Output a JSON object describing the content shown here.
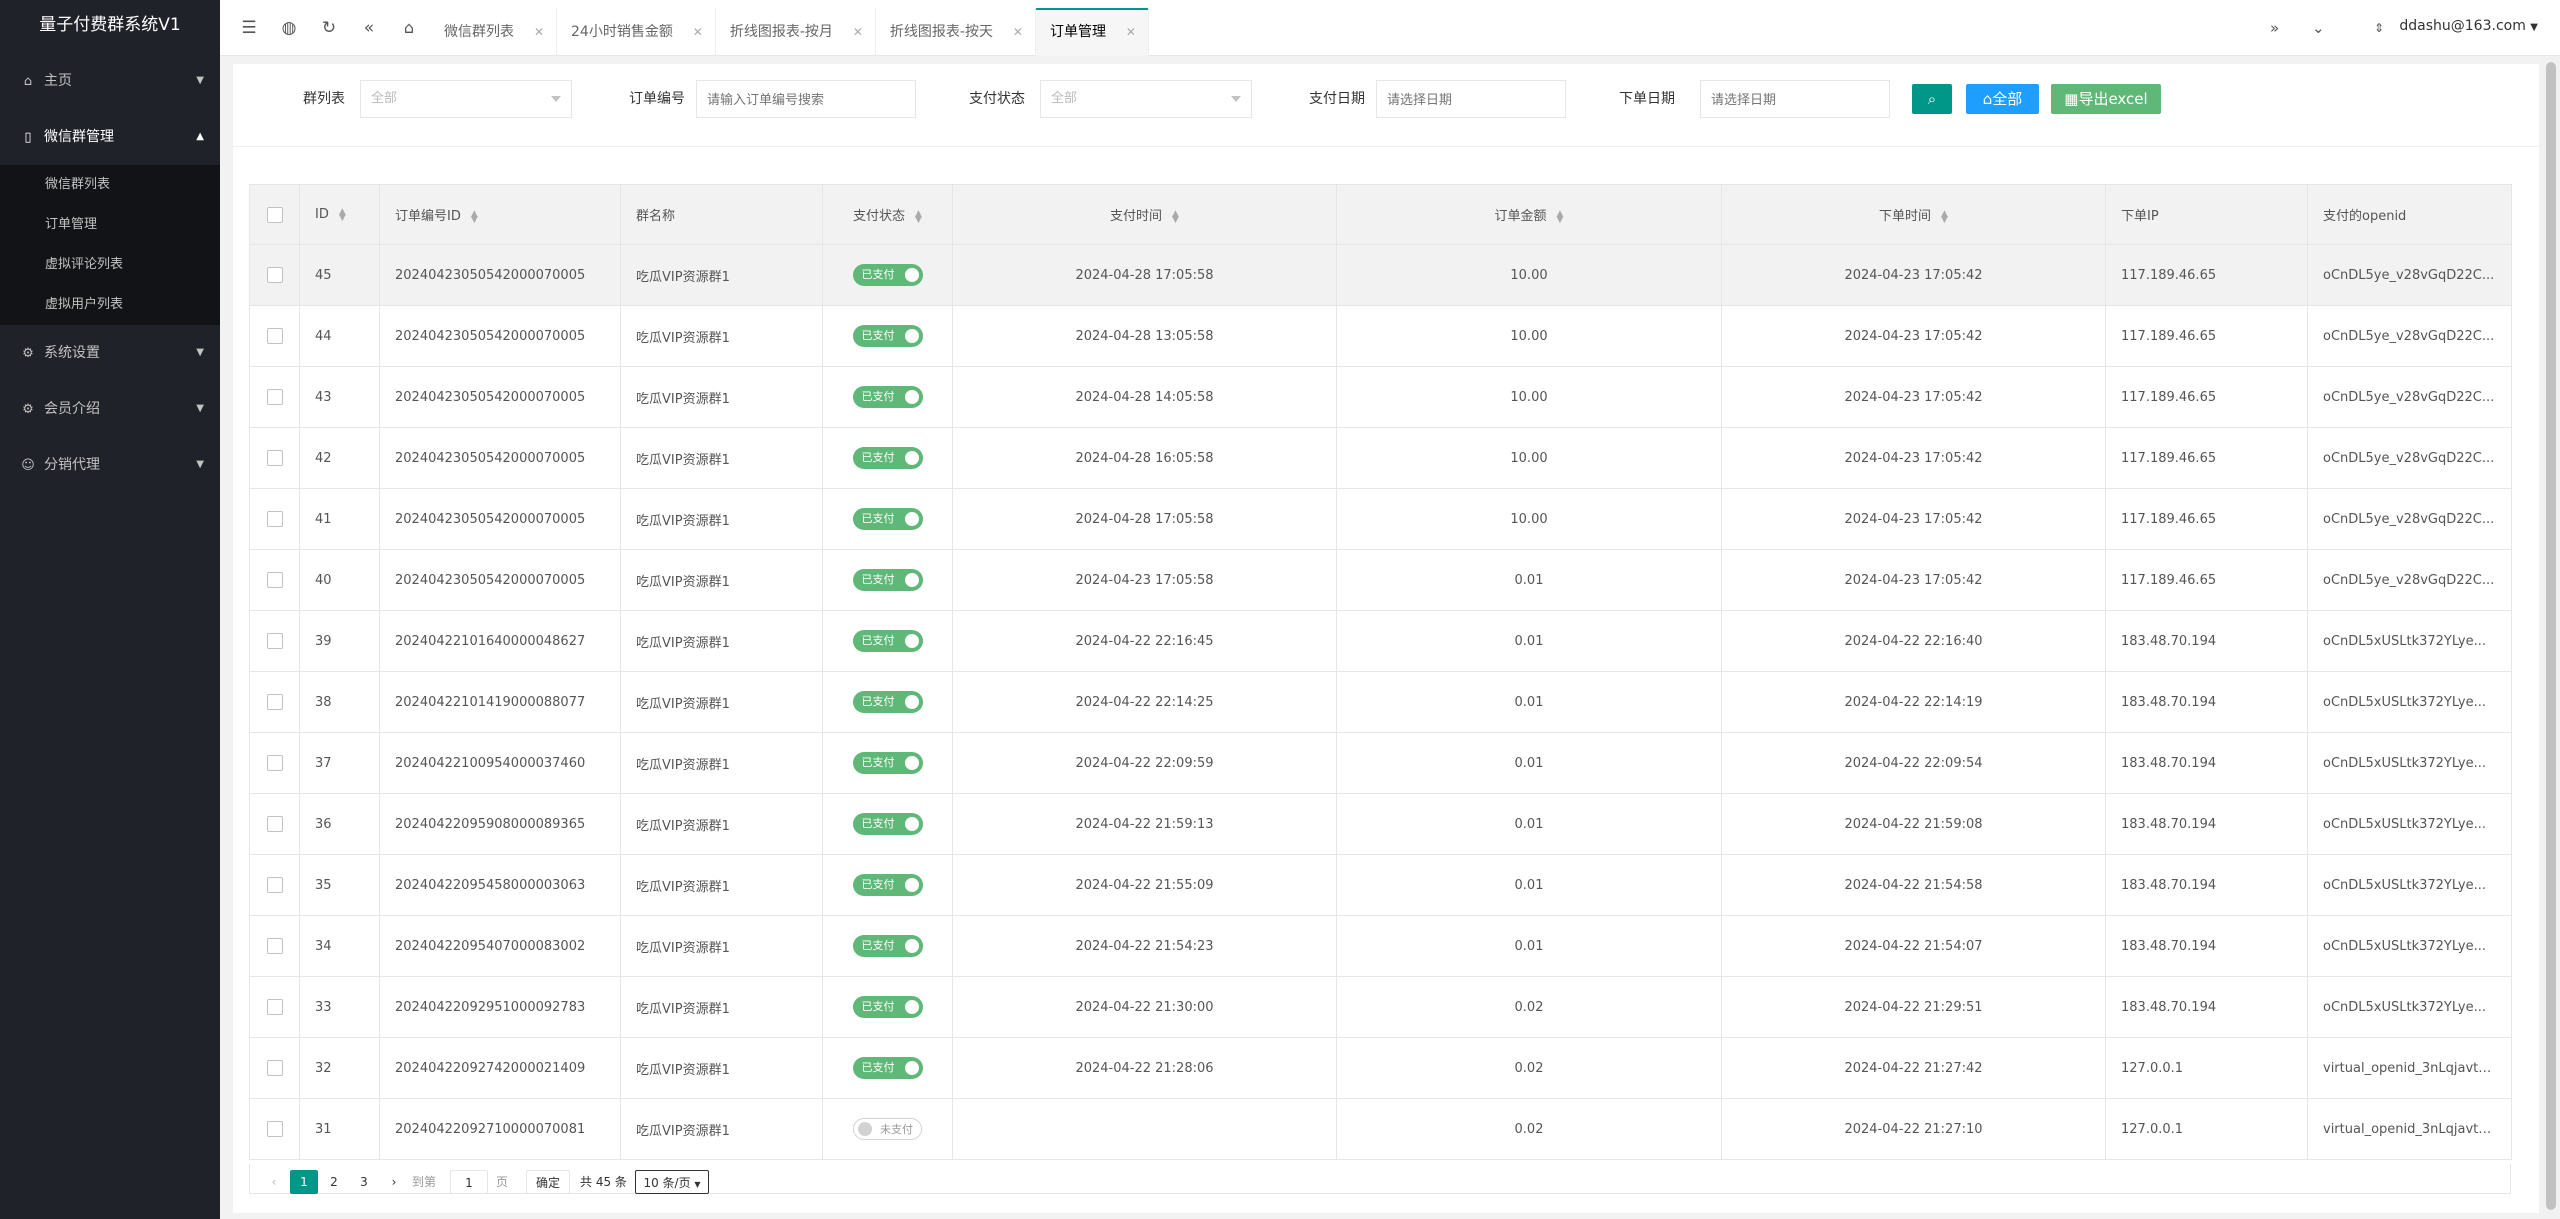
{
  "app": {
    "title": "量子付费群系统V1"
  },
  "sidebar": {
    "items": [
      {
        "label": "主页",
        "icon": "home-icon"
      },
      {
        "label": "微信群管理",
        "icon": "phone-icon"
      },
      {
        "label": "系统设置",
        "icon": "gear-icon"
      },
      {
        "label": "会员介绍",
        "icon": "badge-icon"
      },
      {
        "label": "分销代理",
        "icon": "user-icon"
      }
    ],
    "subitems": [
      "微信群列表",
      "订单管理",
      "虚拟评论列表",
      "虚拟用户列表"
    ]
  },
  "topbar": {
    "tabs": [
      "微信群列表",
      "24小时销售金额",
      "折线图报表-按月",
      "折线图报表-按天",
      "订单管理"
    ],
    "active_tab": "订单管理",
    "user": "ddashu@163.com"
  },
  "filters": {
    "group_label": "群列表",
    "group_value": "全部",
    "order_label": "订单编号",
    "order_placeholder": "请输入订单编号搜索",
    "pay_label": "支付状态",
    "pay_value": "全部",
    "paydate_label": "支付日期",
    "paydate_placeholder": "请选择日期",
    "orderdate_label": "下单日期",
    "orderdate_placeholder": "请选择日期",
    "all_button": "全部",
    "export_button": "导出excel"
  },
  "table": {
    "headers": [
      "ID",
      "订单编号ID",
      "群名称",
      "支付状态",
      "支付时间",
      "订单金额",
      "下单时间",
      "下单IP",
      "支付的openid"
    ],
    "rows": [
      {
        "id": "45",
        "order": "20240423050542000070005",
        "group": "吃瓜VIP资源群1",
        "status": "已支付",
        "paid": true,
        "pay_time": "2024-04-28 17:05:58",
        "amount": "10.00",
        "order_time": "2024-04-23 17:05:42",
        "ip": "117.189.46.65",
        "openid": "oCnDL5ye_v28vGqD22C..."
      },
      {
        "id": "44",
        "order": "20240423050542000070005",
        "group": "吃瓜VIP资源群1",
        "status": "已支付",
        "paid": true,
        "pay_time": "2024-04-28 13:05:58",
        "amount": "10.00",
        "order_time": "2024-04-23 17:05:42",
        "ip": "117.189.46.65",
        "openid": "oCnDL5ye_v28vGqD22C..."
      },
      {
        "id": "43",
        "order": "20240423050542000070005",
        "group": "吃瓜VIP资源群1",
        "status": "已支付",
        "paid": true,
        "pay_time": "2024-04-28 14:05:58",
        "amount": "10.00",
        "order_time": "2024-04-23 17:05:42",
        "ip": "117.189.46.65",
        "openid": "oCnDL5ye_v28vGqD22C..."
      },
      {
        "id": "42",
        "order": "20240423050542000070005",
        "group": "吃瓜VIP资源群1",
        "status": "已支付",
        "paid": true,
        "pay_time": "2024-04-28 16:05:58",
        "amount": "10.00",
        "order_time": "2024-04-23 17:05:42",
        "ip": "117.189.46.65",
        "openid": "oCnDL5ye_v28vGqD22C..."
      },
      {
        "id": "41",
        "order": "20240423050542000070005",
        "group": "吃瓜VIP资源群1",
        "status": "已支付",
        "paid": true,
        "pay_time": "2024-04-28 17:05:58",
        "amount": "10.00",
        "order_time": "2024-04-23 17:05:42",
        "ip": "117.189.46.65",
        "openid": "oCnDL5ye_v28vGqD22C..."
      },
      {
        "id": "40",
        "order": "20240423050542000070005",
        "group": "吃瓜VIP资源群1",
        "status": "已支付",
        "paid": true,
        "pay_time": "2024-04-23 17:05:58",
        "amount": "0.01",
        "order_time": "2024-04-23 17:05:42",
        "ip": "117.189.46.65",
        "openid": "oCnDL5ye_v28vGqD22C..."
      },
      {
        "id": "39",
        "order": "20240422101640000048627",
        "group": "吃瓜VIP资源群1",
        "status": "已支付",
        "paid": true,
        "pay_time": "2024-04-22 22:16:45",
        "amount": "0.01",
        "order_time": "2024-04-22 22:16:40",
        "ip": "183.48.70.194",
        "openid": "oCnDL5xUSLtk372YLye..."
      },
      {
        "id": "38",
        "order": "20240422101419000088077",
        "group": "吃瓜VIP资源群1",
        "status": "已支付",
        "paid": true,
        "pay_time": "2024-04-22 22:14:25",
        "amount": "0.01",
        "order_time": "2024-04-22 22:14:19",
        "ip": "183.48.70.194",
        "openid": "oCnDL5xUSLtk372YLye..."
      },
      {
        "id": "37",
        "order": "20240422100954000037460",
        "group": "吃瓜VIP资源群1",
        "status": "已支付",
        "paid": true,
        "pay_time": "2024-04-22 22:09:59",
        "amount": "0.01",
        "order_time": "2024-04-22 22:09:54",
        "ip": "183.48.70.194",
        "openid": "oCnDL5xUSLtk372YLye..."
      },
      {
        "id": "36",
        "order": "20240422095908000089365",
        "group": "吃瓜VIP资源群1",
        "status": "已支付",
        "paid": true,
        "pay_time": "2024-04-22 21:59:13",
        "amount": "0.01",
        "order_time": "2024-04-22 21:59:08",
        "ip": "183.48.70.194",
        "openid": "oCnDL5xUSLtk372YLye..."
      },
      {
        "id": "35",
        "order": "20240422095458000003063",
        "group": "吃瓜VIP资源群1",
        "status": "已支付",
        "paid": true,
        "pay_time": "2024-04-22 21:55:09",
        "amount": "0.01",
        "order_time": "2024-04-22 21:54:58",
        "ip": "183.48.70.194",
        "openid": "oCnDL5xUSLtk372YLye..."
      },
      {
        "id": "34",
        "order": "20240422095407000083002",
        "group": "吃瓜VIP资源群1",
        "status": "已支付",
        "paid": true,
        "pay_time": "2024-04-22 21:54:23",
        "amount": "0.01",
        "order_time": "2024-04-22 21:54:07",
        "ip": "183.48.70.194",
        "openid": "oCnDL5xUSLtk372YLye..."
      },
      {
        "id": "33",
        "order": "20240422092951000092783",
        "group": "吃瓜VIP资源群1",
        "status": "已支付",
        "paid": true,
        "pay_time": "2024-04-22 21:30:00",
        "amount": "0.02",
        "order_time": "2024-04-22 21:29:51",
        "ip": "183.48.70.194",
        "openid": "oCnDL5xUSLtk372YLye..."
      },
      {
        "id": "32",
        "order": "20240422092742000021409",
        "group": "吃瓜VIP资源群1",
        "status": "已支付",
        "paid": true,
        "pay_time": "2024-04-22 21:28:06",
        "amount": "0.02",
        "order_time": "2024-04-22 21:27:42",
        "ip": "127.0.0.1",
        "openid": "virtual_openid_3nLqjavt3..."
      },
      {
        "id": "31",
        "order": "20240422092710000070081",
        "group": "吃瓜VIP资源群1",
        "status": "未支付",
        "paid": false,
        "pay_time": "",
        "amount": "0.02",
        "order_time": "2024-04-22 21:27:10",
        "ip": "127.0.0.1",
        "openid": "virtual_openid_3nLqjavt3..."
      }
    ]
  },
  "pager": {
    "pages": [
      "1",
      "2",
      "3"
    ],
    "current": "1",
    "goto_label": "到第",
    "goto_value": "1",
    "page_unit": "页",
    "confirm": "确定",
    "total": "共 45 条",
    "page_size": "10 条/页"
  },
  "colors": {
    "accent": "#009688",
    "paid": "#5fb878",
    "search_btn": "#009688",
    "all_btn": "#1e9fff",
    "export_btn": "#5fb878"
  }
}
